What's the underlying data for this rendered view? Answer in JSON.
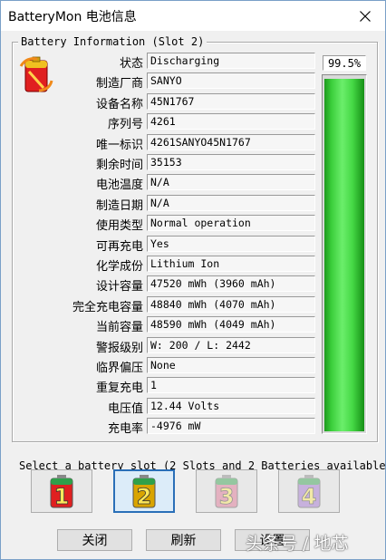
{
  "window": {
    "title": "BatteryMon 电池信息"
  },
  "group": {
    "legend": "Battery Information (Slot 2)"
  },
  "rows": [
    {
      "label": "状态",
      "value": "Discharging"
    },
    {
      "label": "制造厂商",
      "value": "SANYO"
    },
    {
      "label": "设备名称",
      "value": "45N1767"
    },
    {
      "label": "序列号",
      "value": " 4261"
    },
    {
      "label": "唯一标识",
      "value": " 4261SANYO45N1767"
    },
    {
      "label": "剩余时间",
      "value": "35153"
    },
    {
      "label": "电池温度",
      "value": "N/A"
    },
    {
      "label": "制造日期",
      "value": "N/A"
    },
    {
      "label": "使用类型",
      "value": "Normal operation"
    },
    {
      "label": "可再充电",
      "value": "Yes"
    },
    {
      "label": "化学成份",
      "value": "Lithium Ion"
    },
    {
      "label": "设计容量",
      "value": "47520 mWh (3960 mAh)"
    },
    {
      "label": "完全充电容量",
      "value": "48840 mWh (4070 mAh)"
    },
    {
      "label": "当前容量",
      "value": "48590 mWh (4049 mAh)"
    },
    {
      "label": "警报级别",
      "value": "W: 200 / L: 2442"
    },
    {
      "label": "临界偏压",
      "value": "None"
    },
    {
      "label": "重复充电",
      "value": "1"
    },
    {
      "label": "电压值",
      "value": "12.44 Volts"
    },
    {
      "label": "充电率",
      "value": "-4976 mW"
    }
  ],
  "charge": {
    "percent_text": "99.5%",
    "level": 0.995,
    "color": "#3ccf3c"
  },
  "slots": {
    "caption": "Select a battery slot (2 Slots and 2 Batteries available)",
    "items": [
      {
        "number": "1",
        "state": "normal"
      },
      {
        "number": "2",
        "state": "active"
      },
      {
        "number": "3",
        "state": "disabled"
      },
      {
        "number": "4",
        "state": "disabled"
      }
    ]
  },
  "buttons": {
    "close": "关闭",
    "refresh": "刷新",
    "other": "设置"
  },
  "watermark": "头条号 / 地芯",
  "icons": {
    "app": "battery-icon",
    "close": "close-icon"
  }
}
